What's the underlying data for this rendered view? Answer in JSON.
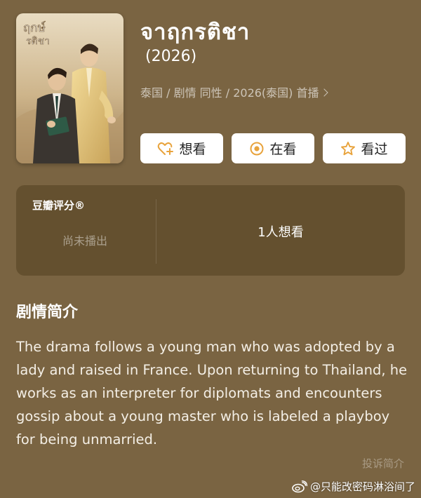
{
  "header": {
    "title": "จาฤกรติชา",
    "year": "(2026)",
    "meta": "泰国 / 剧情 同性 / 2026(泰国) 首播"
  },
  "actions": {
    "want": "想看",
    "watching": "在看",
    "watched": "看过"
  },
  "rating": {
    "brand": "豆瓣评分®",
    "status": "尚未播出",
    "want_count": "1人想看"
  },
  "synopsis": {
    "title": "剧情简介",
    "text": "The drama follows a young man who was adopted by a lady and raised in France. Upon returning to Thailand, he works as an interpreter for diplomats and encounters gossip about a young master who is labeled a playboy for being unmarried.",
    "report": "投诉简介"
  },
  "watermark": {
    "text": "@只能改密码淋浴间了",
    "icon": "weibo-icon"
  },
  "colors": {
    "background": "#7a6442",
    "card": "#64502f",
    "button_bg": "#ffffff",
    "accent": "#e8a33c"
  }
}
